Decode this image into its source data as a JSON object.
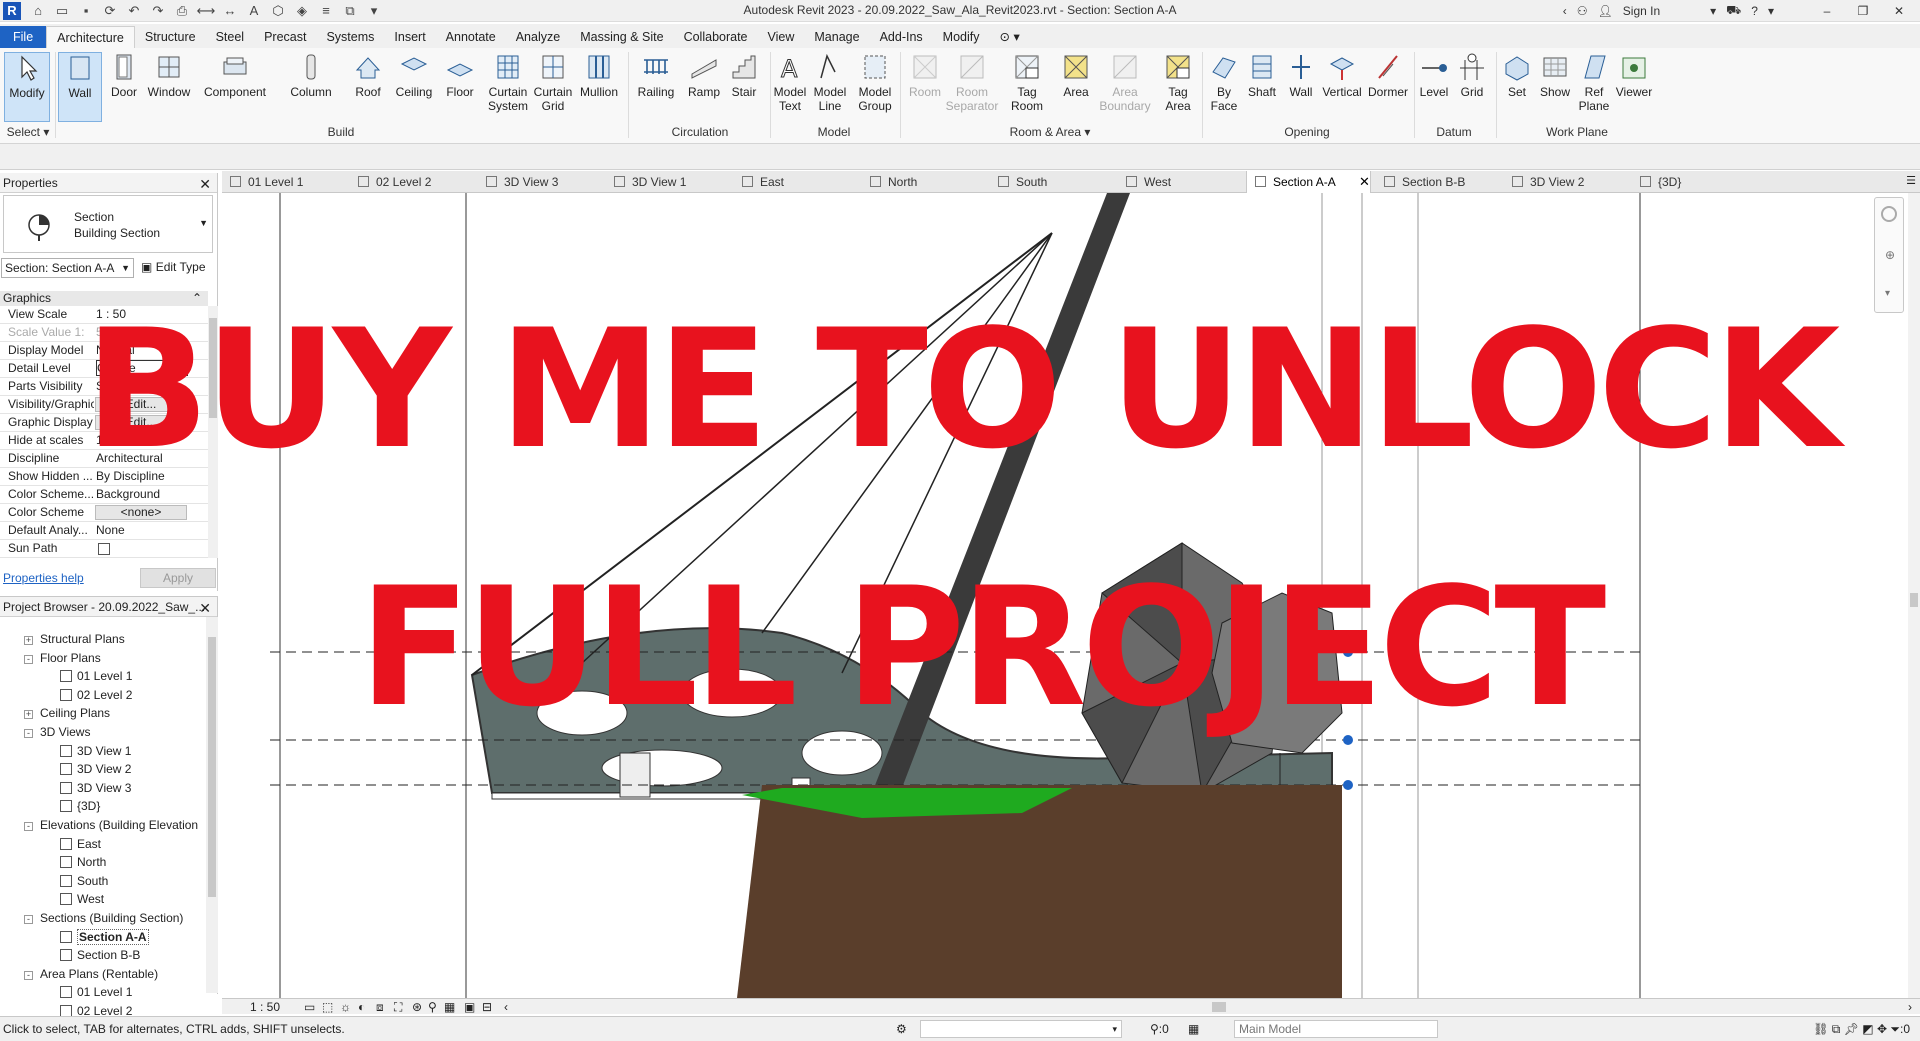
{
  "app": {
    "title": "Autodesk Revit 2023 - 20.09.2022_Saw_Ala_Revit2023.rvt - Section: Section A-A",
    "sign_in": "Sign In"
  },
  "ribbon_tabs": [
    "File",
    "Architecture",
    "Structure",
    "Steel",
    "Precast",
    "Systems",
    "Insert",
    "Annotate",
    "Analyze",
    "Massing & Site",
    "Collaborate",
    "View",
    "Manage",
    "Add-Ins",
    "Modify"
  ],
  "ribbon": {
    "select": {
      "modify": "Modify",
      "label": "Select"
    },
    "build": {
      "label": "Build",
      "tools": [
        "Wall",
        "Door",
        "Window",
        "Component",
        "Column",
        "Roof",
        "Ceiling",
        "Floor",
        "Curtain System",
        "Curtain Grid",
        "Mullion"
      ]
    },
    "circulation": {
      "label": "Circulation",
      "tools": [
        "Railing",
        "Ramp",
        "Stair"
      ]
    },
    "model": {
      "label": "Model",
      "tools": [
        "Model Text",
        "Model Line",
        "Model Group"
      ]
    },
    "room_area": {
      "label": "Room & Area",
      "tools": [
        "Room",
        "Room Separator",
        "Tag Room",
        "Area",
        "Area Boundary",
        "Tag Area"
      ]
    },
    "opening": {
      "label": "Opening",
      "tools": [
        "By Face",
        "Shaft",
        "Wall",
        "Vertical",
        "Dormer"
      ]
    },
    "datum": {
      "label": "Datum",
      "tools": [
        "Level",
        "Grid"
      ]
    },
    "work_plane": {
      "label": "Work Plane",
      "tools": [
        "Set",
        "Show",
        "Ref Plane",
        "Viewer"
      ]
    }
  },
  "properties": {
    "header": "Properties",
    "family": "Section",
    "type": "Building Section",
    "instance_selector": "Section: Section A-A",
    "edit_type": "Edit Type",
    "group": "Graphics",
    "rows": [
      {
        "k": "View Scale",
        "v": "1 : 50"
      },
      {
        "k": "Scale Value  1:",
        "v": "50"
      },
      {
        "k": "Display Model",
        "v": "Normal"
      },
      {
        "k": "Detail Level",
        "v": "Coarse"
      },
      {
        "k": "Parts Visibility",
        "v": "Show Original"
      },
      {
        "k": "Visibility/Graphics",
        "v": "Edit..."
      },
      {
        "k": "Graphic Display",
        "v": "Edit..."
      },
      {
        "k": "Hide at scales",
        "v": "1 : 100"
      },
      {
        "k": "Discipline",
        "v": "Architectural"
      },
      {
        "k": "Show Hidden ...",
        "v": "By Discipline"
      },
      {
        "k": "Color Scheme...",
        "v": "Background"
      },
      {
        "k": "Color Scheme",
        "v": "<none>"
      },
      {
        "k": "Default Analy...",
        "v": "None"
      },
      {
        "k": "Sun Path",
        "v": ""
      }
    ],
    "help": "Properties help",
    "apply": "Apply"
  },
  "browser": {
    "header": "Project Browser - 20.09.2022_Saw_...",
    "nodes": [
      {
        "label": "Structural Plans",
        "level": 1,
        "toggle": "+"
      },
      {
        "label": "Floor Plans",
        "level": 1,
        "toggle": "-"
      },
      {
        "label": "01 Level 1",
        "level": 2
      },
      {
        "label": "02 Level 2",
        "level": 2
      },
      {
        "label": "Ceiling Plans",
        "level": 1,
        "toggle": "+"
      },
      {
        "label": "3D Views",
        "level": 1,
        "toggle": "-"
      },
      {
        "label": "3D View 1",
        "level": 2
      },
      {
        "label": "3D View 2",
        "level": 2
      },
      {
        "label": "3D View 3",
        "level": 2
      },
      {
        "label": "{3D}",
        "level": 2
      },
      {
        "label": "Elevations (Building Elevation",
        "level": 1,
        "toggle": "-"
      },
      {
        "label": "East",
        "level": 2
      },
      {
        "label": "North",
        "level": 2
      },
      {
        "label": "South",
        "level": 2
      },
      {
        "label": "West",
        "level": 2
      },
      {
        "label": "Sections (Building Section)",
        "level": 1,
        "toggle": "-"
      },
      {
        "label": "Section A-A",
        "level": 2,
        "selected": true
      },
      {
        "label": "Section B-B",
        "level": 2
      },
      {
        "label": "Area Plans (Rentable)",
        "level": 1,
        "toggle": "-"
      },
      {
        "label": "01 Level 1",
        "level": 2
      },
      {
        "label": "02 Level 2",
        "level": 2
      }
    ]
  },
  "view_tabs": [
    "01 Level 1",
    "02 Level 2",
    "3D View 3",
    "3D View 1",
    "East",
    "North",
    "South",
    "West",
    "Section A-A",
    "Section B-B",
    "3D View 2",
    "{3D}"
  ],
  "active_view_tab": "Section A-A",
  "watermark": {
    "line1": "BUY ME TO UNLOCK",
    "line2": "FULL PROJECT"
  },
  "viewbar": {
    "scale": "1 : 50"
  },
  "status": {
    "message": "Click to select, TAB for alternates, CTRL adds, SHIFT unselects.",
    "zero": ":0",
    "model": "Main Model",
    "right_zero": ":0"
  },
  "colors": {
    "accent": "#1e63c4",
    "watermark": "#e8121e",
    "glass": "#5e6e6c",
    "ground": "#5a3e2b",
    "grass": "#1faa1f"
  }
}
